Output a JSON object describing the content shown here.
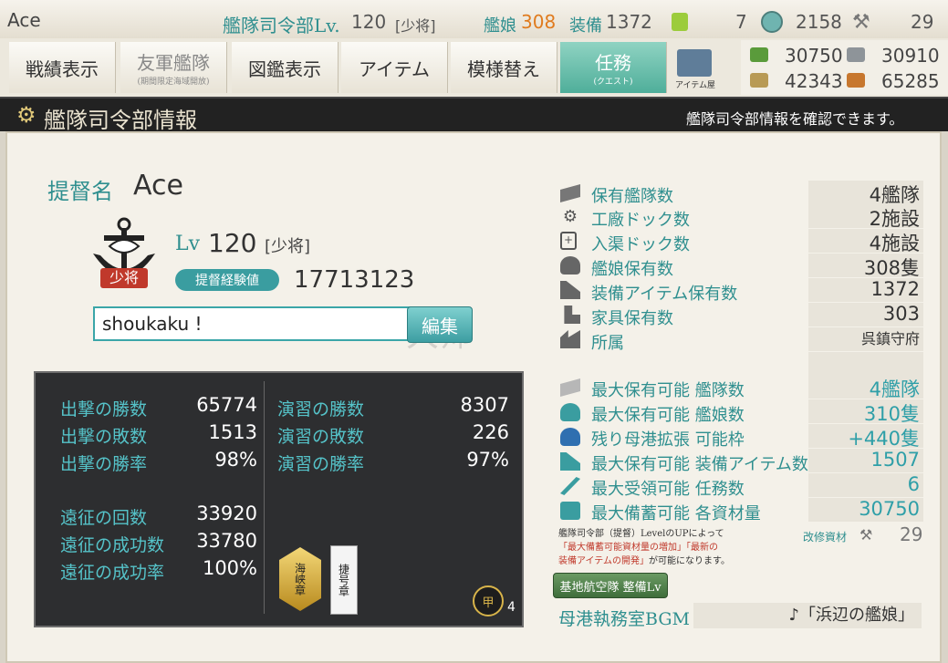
{
  "topbar": {
    "player_name": "Ace",
    "hq_level_label": "艦隊司令部Lv.",
    "hq_level": "120",
    "rank": "[少将]",
    "shipgirls_label": "艦娘",
    "shipgirls": "308",
    "equip_label": "装備",
    "equip": "1372",
    "bucket": "7",
    "devmat": "2158",
    "screw": "29"
  },
  "nav": {
    "items": [
      {
        "label": "戦績表示"
      },
      {
        "label": "友軍艦隊",
        "sub": "(期間限定海域開放)"
      },
      {
        "label": "図鑑表示"
      },
      {
        "label": "アイテム"
      },
      {
        "label": "模様替え"
      },
      {
        "label": "任務",
        "sub": "(クエスト)"
      }
    ],
    "item_shop_label": "アイテム屋"
  },
  "resources": {
    "fuel": "30750",
    "steel": "30910",
    "ammo": "42343",
    "bauxite": "65285"
  },
  "header": {
    "title": "艦隊司令部情報",
    "description": "艦隊司令部情報を確認できます。"
  },
  "profile": {
    "admiral_label": "提督名",
    "admiral_name": "Ace",
    "rank_badge": "少将",
    "lv_label": "Lv",
    "level": "120",
    "rank": "[少将]",
    "exp_label": "提督経験値",
    "exp": "17713123",
    "comment": "shoukaku !",
    "edit_button": "編集",
    "watermark": "大师"
  },
  "stats": {
    "sortie_wins_label": "出撃の勝数",
    "sortie_wins": "65774",
    "sortie_losses_label": "出撃の敗数",
    "sortie_losses": "1513",
    "sortie_rate_label": "出撃の勝率",
    "sortie_rate": "98%",
    "exercise_wins_label": "演習の勝数",
    "exercise_wins": "8307",
    "exercise_losses_label": "演習の敗数",
    "exercise_losses": "226",
    "exercise_rate_label": "演習の勝率",
    "exercise_rate": "97%",
    "expedition_count_label": "遠征の回数",
    "expedition_count": "33920",
    "expedition_success_label": "遠征の成功数",
    "expedition_success": "33780",
    "expedition_rate_label": "遠征の成功率",
    "expedition_rate": "100%",
    "medal_1": "海峡章",
    "medal_2": "捷号章",
    "medal_3": "甲",
    "medal_count": "4"
  },
  "right": {
    "fleets_label": "保有艦隊数",
    "fleets": "4艦隊",
    "docks_label": "工廠ドック数",
    "docks": "2施設",
    "repair_label": "入渠ドック数",
    "repair": "4施設",
    "ships_label": "艦娘保有数",
    "ships": "308隻",
    "equip_label": "装備アイテム保有数",
    "equip": "1372",
    "furniture_label": "家具保有数",
    "furniture": "303",
    "affiliation_label": "所属",
    "affiliation": "呉鎮守府",
    "max_fleets_label": "最大保有可能 艦隊数",
    "max_fleets": "4艦隊",
    "max_ships_label": "最大保有可能 艦娘数",
    "max_ships": "310隻",
    "expansion_label": "残り母港拡張 可能枠",
    "expansion": "+440隻",
    "max_equip_label": "最大保有可能 装備アイテム数",
    "max_equip": "1507",
    "max_quests_label": "最大受領可能 任務数",
    "max_quests": "6",
    "max_res_label": "最大備蓄可能 各資材量",
    "max_res": "30750",
    "note_1": "艦隊司令部（提督）LevelのUPによって",
    "note_2": "「最大備蓄可能資材量の増加」「最新の",
    "note_3": "装備アイテムの開発」",
    "note_4": "が可能になります。",
    "kaishu_label": "改修資材",
    "kaishu": "29",
    "base_button": "基地航空隊 整備Lv",
    "bgm_label": "母港執務室BGM",
    "bgm": "♪「浜辺の艦娘」"
  },
  "colors": {
    "accent": "#2f8f8f",
    "orange": "#e07b1e",
    "band": "#222222"
  }
}
